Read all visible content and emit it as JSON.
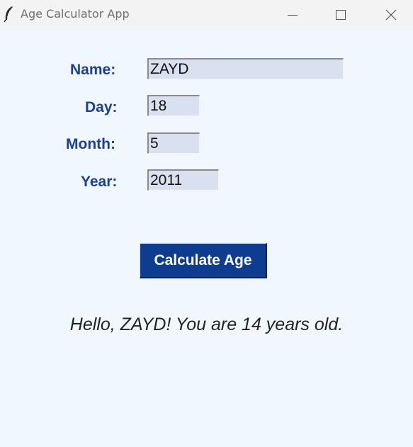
{
  "window": {
    "title": "Age Calculator App",
    "icon": "feather-icon",
    "controls": [
      "minimize-icon",
      "maximize-icon",
      "close-icon"
    ]
  },
  "form": {
    "name_label": "Name:",
    "name_value": "ZAYD",
    "day_label": "Day:",
    "day_value": "18",
    "month_label": "Month:",
    "month_value": "5",
    "year_label": "Year:",
    "year_value": "2011"
  },
  "calculate_label": "Calculate Age",
  "result_text": "Hello, ZAYD! You are 14 years old.",
  "colors": {
    "background": "#f0f7ff",
    "label": "#1f3f8f",
    "button": "#0e3d8f",
    "field": "#d9e1f0"
  }
}
